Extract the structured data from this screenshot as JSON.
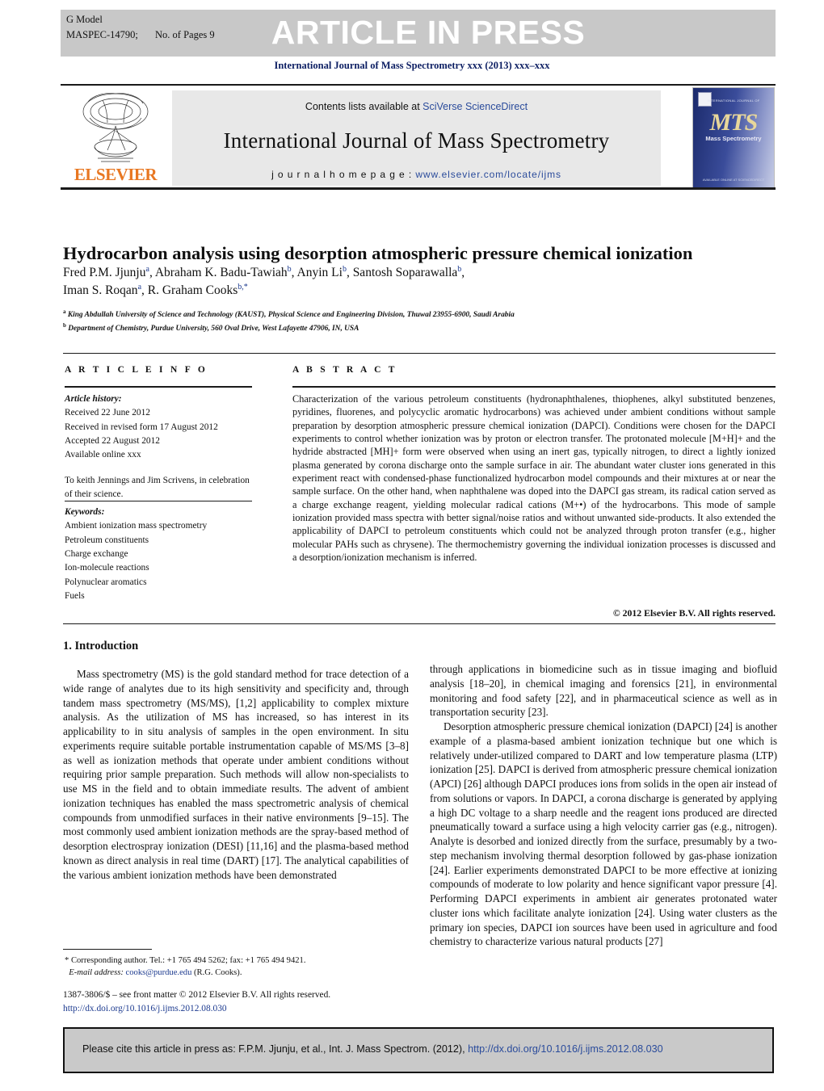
{
  "banner": {
    "g_model": "G Model",
    "ms_id": "MASPEC-14790;",
    "pages": "No. of Pages 9",
    "article_in_press": "ARTICLE IN PRESS"
  },
  "journal_line": "International Journal of Mass Spectrometry xxx (2013) xxx–xxx",
  "masthead": {
    "contents_prefix": "Contents lists available at ",
    "contents_link": "SciVerse ScienceDirect",
    "journal_title": "International Journal of Mass Spectrometry",
    "homepage_label": "j o u r n a l   h o m e p a g e :  ",
    "homepage_url": "www.elsevier.com/locate/ijms",
    "publisher": "ELSEVIER",
    "cover": {
      "logo_text": "MTS",
      "subtitle": "Mass Spectrometry",
      "top_text": "INTERNATIONAL JOURNAL OF",
      "bottom_text": "AVAILABLE ONLINE AT SCIENCEDIRECT"
    }
  },
  "article": {
    "title": "Hydrocarbon analysis using desorption atmospheric pressure chemical ionization",
    "authors_line1": "Fred P.M. Jjunju",
    "authors_line1_sup": "a",
    "authors": [
      {
        "name": "Fred P.M. Jjunju",
        "sup": "a"
      },
      {
        "name": "Abraham K. Badu-Tawiah",
        "sup": "b"
      },
      {
        "name": "Anyin Li",
        "sup": "b"
      },
      {
        "name": "Santosh Soparawalla",
        "sup": "b"
      },
      {
        "name": "Iman S. Roqan",
        "sup": "a"
      },
      {
        "name": "R. Graham Cooks",
        "sup": "b,*"
      }
    ],
    "affiliations": [
      {
        "mark": "a",
        "text": "King Abdullah University of Science and Technology (KAUST), Physical Science and Engineering Division, Thuwal 23955-6900, Saudi Arabia"
      },
      {
        "mark": "b",
        "text": "Department of Chemistry, Purdue University, 560 Oval Drive, West Lafayette 47906, IN, USA"
      }
    ]
  },
  "article_info": {
    "heading": "A R T I C L E   I N F O",
    "history_label": "Article history:",
    "history": [
      "Received 22 June 2012",
      "Received in revised form 17 August 2012",
      "Accepted 22 August 2012",
      "Available online xxx"
    ],
    "dedication": "To keith Jennings and Jim Scrivens, in celebration of their science.",
    "keywords_label": "Keywords:",
    "keywords": [
      "Ambient ionization mass spectrometry",
      "Petroleum constituents",
      "Charge exchange",
      "Ion-molecule reactions",
      "Polynuclear aromatics",
      "Fuels"
    ]
  },
  "abstract": {
    "heading": "A B S T R A C T",
    "text": "Characterization of the various petroleum constituents (hydronaphthalenes, thiophenes, alkyl substituted benzenes, pyridines, fluorenes, and polycyclic aromatic hydrocarbons) was achieved under ambient conditions without sample preparation by desorption atmospheric pressure chemical ionization (DAPCI). Conditions were chosen for the DAPCI experiments to control whether ionization was by proton or electron transfer. The protonated molecule [M+H]+ and the hydride abstracted [MH]+ form were observed when using an inert gas, typically nitrogen, to direct a lightly ionized plasma generated by corona discharge onto the sample surface in air. The abundant water cluster ions generated in this experiment react with condensed-phase functionalized hydrocarbon model compounds and their mixtures at or near the sample surface. On the other hand, when naphthalene was doped into the DAPCI gas stream, its radical cation served as a charge exchange reagent, yielding molecular radical cations (M+•) of the hydrocarbons. This mode of sample ionization provided mass spectra with better signal/noise ratios and without unwanted side-products. It also extended the applicability of DAPCI to petroleum constituents which could not be analyzed through proton transfer (e.g., higher molecular PAHs such as chrysene). The thermochemistry governing the individual ionization processes is discussed and a desorption/ionization mechanism is inferred.",
    "copyright": "© 2012 Elsevier B.V. All rights reserved."
  },
  "body": {
    "section_title": "1.  Introduction",
    "left_p1": "Mass spectrometry (MS) is the gold standard method for trace detection of a wide range of analytes due to its high sensitivity and specificity and, through tandem mass spectrometry (MS/MS), [1,2] applicability to complex mixture analysis. As the utilization of MS has increased, so has interest in its applicability to in situ analysis of samples in the open environment. In situ experiments require suitable portable instrumentation capable of MS/MS [3–8] as well as ionization methods that operate under ambient conditions without requiring prior sample preparation. Such methods will allow non-specialists to use MS in the field and to obtain immediate results. The advent of ambient ionization techniques has enabled the mass spectrometric analysis of chemical compounds from unmodified surfaces in their native environments [9–15]. The most commonly used ambient ionization methods are the spray-based method of desorption electrospray ionization (DESI) [11,16] and the plasma-based method known as direct analysis in real time (DART) [17]. The analytical capabilities of the various ambient ionization methods have been demonstrated",
    "right_p1": "through applications in biomedicine such as in tissue imaging and biofluid analysis [18–20], in chemical imaging and forensics [21], in environmental monitoring and food safety [22], and in pharmaceutical science as well as in transportation security [23].",
    "right_p2": "Desorption atmospheric pressure chemical ionization (DAPCI) [24] is another example of a plasma-based ambient ionization technique but one which is relatively under-utilized compared to DART and low temperature plasma (LTP) ionization [25]. DAPCI is derived from atmospheric pressure chemical ionization (APCI) [26] although DAPCI produces ions from solids in the open air instead of from solutions or vapors. In DAPCI, a corona discharge is generated by applying a high DC voltage to a sharp needle and the reagent ions produced are directed pneumatically toward a surface using a high velocity carrier gas (e.g., nitrogen). Analyte is desorbed and ionized directly from the surface, presumably by a two-step mechanism involving thermal desorption followed by gas-phase ionization [24]. Earlier experiments demonstrated DAPCI to be more effective at ionizing compounds of moderate to low polarity and hence significant vapor pressure [4]. Performing DAPCI experiments in ambient air generates protonated water cluster ions which facilitate analyte ionization [24]. Using water clusters as the primary ion species, DAPCI ion sources have been used in agriculture and food chemistry to characterize various natural products [27]"
  },
  "footnote": {
    "corresponding": "* Corresponding author. Tel.: +1 765 494 5262; fax: +1 765 494 9421.",
    "email_label": "E-mail address:",
    "email": "cooks@purdue.edu",
    "email_suffix": "(R.G. Cooks).",
    "imprint_line": "1387-3806/$ – see front matter © 2012 Elsevier B.V. All rights reserved.",
    "doi": "http://dx.doi.org/10.1016/j.ijms.2012.08.030"
  },
  "cite_box": {
    "prefix": "Please cite this article in press as: F.P.M. Jjunju, et al., Int. J. Mass Spectrom. (2012), ",
    "doi": "http://dx.doi.org/10.1016/j.ijms.2012.08.030"
  },
  "colors": {
    "banner_bg": "#c8c8c8",
    "link": "#2a4b9b",
    "ref": "#1c3a8f",
    "journal_line": "#0d1f63",
    "elsevier_orange": "#e87722"
  }
}
